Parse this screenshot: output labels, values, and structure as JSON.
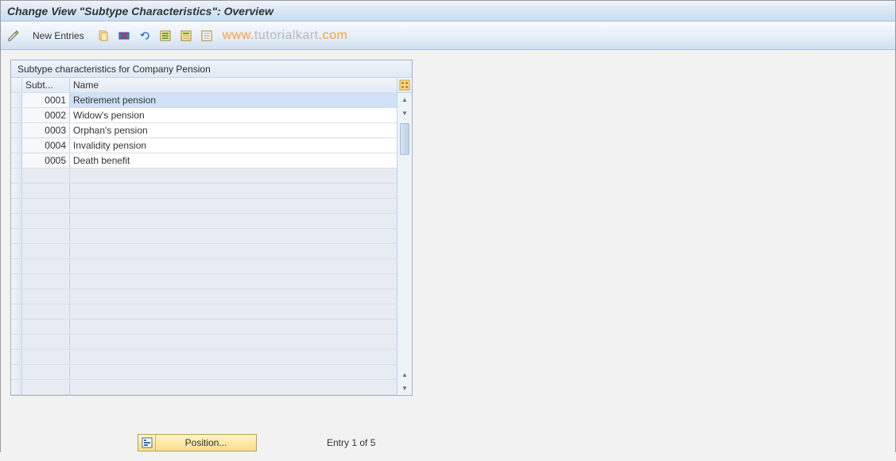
{
  "header": {
    "title": "Change View \"Subtype Characteristics\": Overview"
  },
  "toolbar": {
    "new_entries_label": "New Entries"
  },
  "watermark": {
    "orange": "www.",
    "gray": "tutorialkart",
    "orange2": ".com"
  },
  "table": {
    "title": "Subtype characteristics for Company Pension",
    "col_subt": "Subt...",
    "col_name": "Name",
    "rows": [
      {
        "subt": "0001",
        "name": "Retirement pension"
      },
      {
        "subt": "0002",
        "name": "Widow's pension"
      },
      {
        "subt": "0003",
        "name": "Orphan's pension"
      },
      {
        "subt": "0004",
        "name": "Invalidity pension"
      },
      {
        "subt": "0005",
        "name": "Death benefit"
      }
    ]
  },
  "footer": {
    "position_label": "Position...",
    "entry_status": "Entry 1 of 5"
  }
}
